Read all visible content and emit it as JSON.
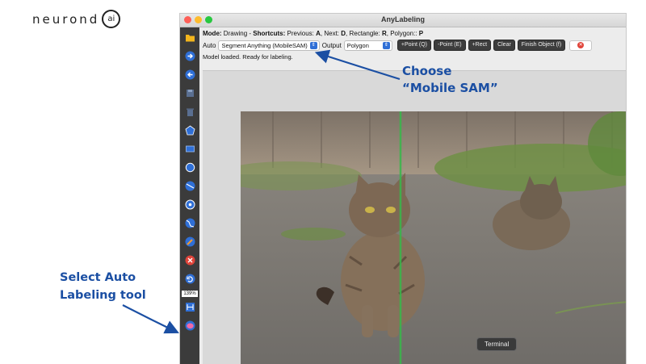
{
  "brand": {
    "logo_text": "neurond",
    "logo_mark": "ai"
  },
  "window": {
    "title": "AnyLabeling"
  },
  "mode_line": {
    "mode_label": "Mode:",
    "mode_value": "Drawing",
    "dash": "-",
    "shortcuts_label": "Shortcuts:",
    "prev_label": "Previous:",
    "prev_key": "A",
    "next_label": ", Next:",
    "next_key": "D",
    "rect_label": ", Rectangle:",
    "rect_key": "R",
    "poly_label": ", Polygon::",
    "poly_key": "P"
  },
  "controls": {
    "auto_label": "Auto",
    "model_selected": "Segment Anything (MobileSAM)",
    "output_label": "Output",
    "output_selected": "Polygon",
    "buttons": [
      "+Point (Q)",
      "-Point (E)",
      "+Rect",
      "Clear",
      "Finish Object (f)"
    ],
    "close_glyph": "✕"
  },
  "status_text": "Model loaded. Ready for labeling.",
  "zoom_level": "139%",
  "tooltip": "Terminal",
  "annotations": {
    "choose_line1": "Choose",
    "choose_line2": "“Mobile SAM”",
    "select_line1": "Select Auto",
    "select_line2": "Labeling tool"
  },
  "colors": {
    "annotation_blue": "#1b4fa3",
    "toolbar_bg": "#3b3b3b",
    "tool_icon_blue": "#2f6fd6"
  },
  "tools": [
    "open-folder-icon",
    "next-image-icon",
    "prev-image-icon",
    "save-icon",
    "delete-icon",
    "polygon-icon",
    "rectangle-icon",
    "circle-icon",
    "line-icon",
    "point-icon",
    "linestrip-icon",
    "edit-icon",
    "remove-icon",
    "undo-icon",
    "fit-window-icon",
    "auto-labeling-brain-icon"
  ]
}
